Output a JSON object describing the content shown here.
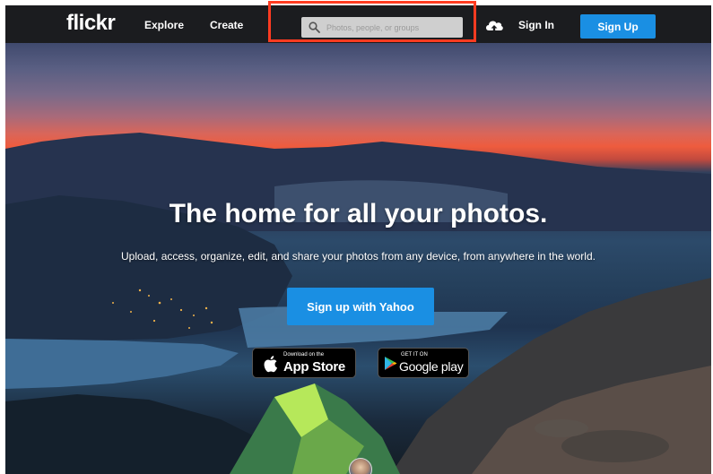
{
  "nav": {
    "logo": "flickr",
    "explore": "Explore",
    "create": "Create",
    "search_placeholder": "Photos, people, or groups",
    "sign_in": "Sign In",
    "sign_up": "Sign Up"
  },
  "hero": {
    "headline": "The home for all your photos.",
    "subhead": "Upload, access, organize, edit, and share your photos from any device, from anywhere in the world.",
    "cta": "Sign up with Yahoo"
  },
  "badges": {
    "appstore_small": "Download on the",
    "appstore_big": "App Store",
    "googleplay_small": "GET IT ON",
    "googleplay_big": "Google play"
  },
  "icons": {
    "search": "search-icon",
    "upload": "cloud-upload-icon",
    "apple": "apple-icon",
    "play": "google-play-icon"
  },
  "colors": {
    "navbar": "#1b1c1f",
    "brand_blue": "#1a8fe3",
    "highlight": "#ff3b21"
  }
}
